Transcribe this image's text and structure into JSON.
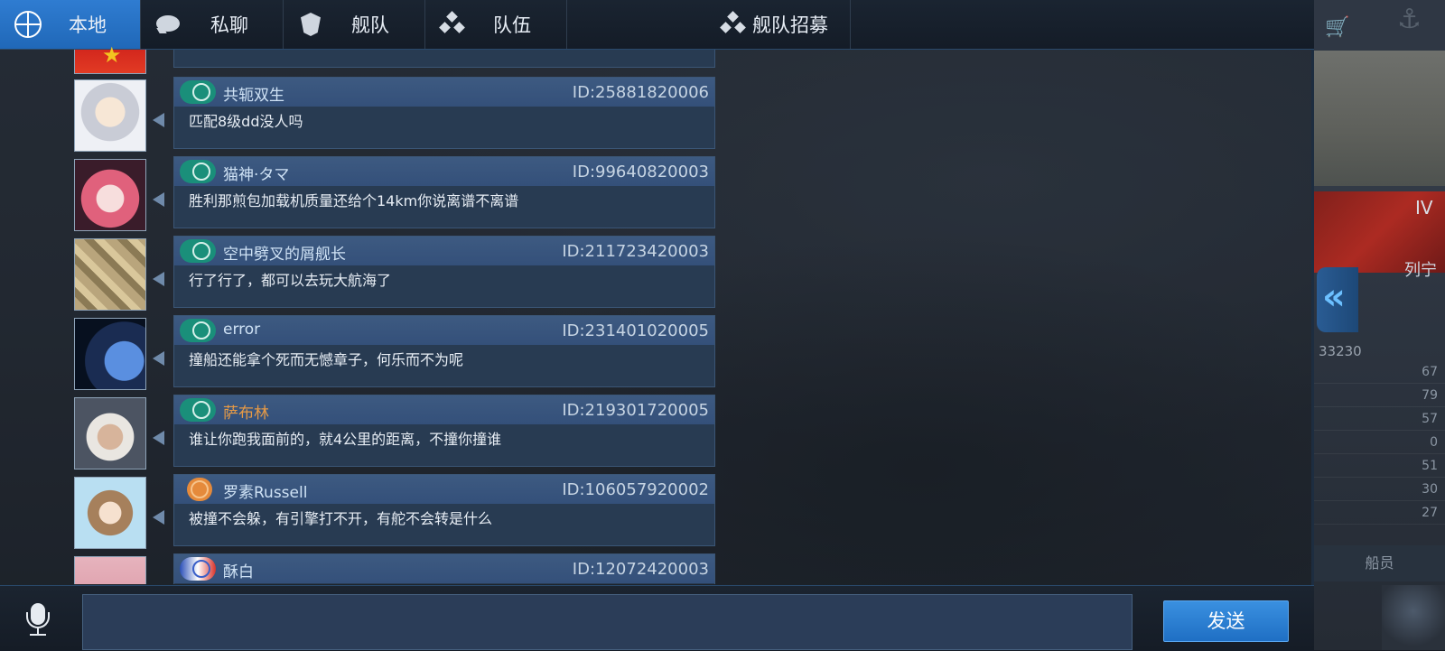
{
  "tabs": [
    {
      "label": "本地",
      "icon": "globe-icon",
      "active": true
    },
    {
      "label": "私聊",
      "icon": "chat-bubble-icon",
      "active": false
    },
    {
      "label": "舰队",
      "icon": "fleet-shield-icon",
      "active": false
    },
    {
      "label": "队伍",
      "icon": "team-icon",
      "active": false
    },
    {
      "label": "舰队招募",
      "icon": "recruit-icon",
      "active": false
    }
  ],
  "messages": [
    {
      "name": "共轭双生",
      "id": "ID:25881820006",
      "text": "匹配8级dd没人吗",
      "badge": "teal-badge"
    },
    {
      "name": "猫神·タマ",
      "id": "ID:99640820003",
      "text": "胜利那煎包加载机质量还给个14km你说离谱不离谱",
      "badge": "teal-badge"
    },
    {
      "name": "空中劈叉的屑舰长",
      "id": "ID:211723420003",
      "text": "行了行了，都可以去玩大航海了",
      "badge": "teal-badge"
    },
    {
      "name": "error",
      "id": "ID:231401020005",
      "text": "撞船还能拿个死而无憾章子，何乐而不为呢",
      "badge": "teal-badge"
    },
    {
      "name": "萨布林",
      "id": "ID:219301720005",
      "text": "谁让你跑我面前的，就4公里的距离，不撞你撞谁",
      "badge": "teal-badge",
      "name_color": "#e69a46"
    },
    {
      "name": "罗素Russell",
      "id": "ID:106057920002",
      "text": "被撞不会躲，有引擎打不开，有舵不会转是什么",
      "badge": "orange-badge"
    },
    {
      "name": "酥白",
      "id": "ID:12072420003",
      "text": "",
      "badge": "tricolor-badge"
    }
  ],
  "input": {
    "value": "",
    "placeholder": ""
  },
  "send_label": "发送",
  "side_panel": {
    "tier": "IV",
    "ship_name": "列宁",
    "score": "33230",
    "stats": [
      "67",
      "79",
      "57",
      "0",
      "51",
      "30",
      "27"
    ],
    "crew_label": "船员"
  },
  "collapse_icon": "double-chevron-left-icon",
  "colors": {
    "accent": "#2f7cd1",
    "card": "#283b52",
    "card_header": "#3d5a81",
    "highlight_name": "#e69a46"
  }
}
